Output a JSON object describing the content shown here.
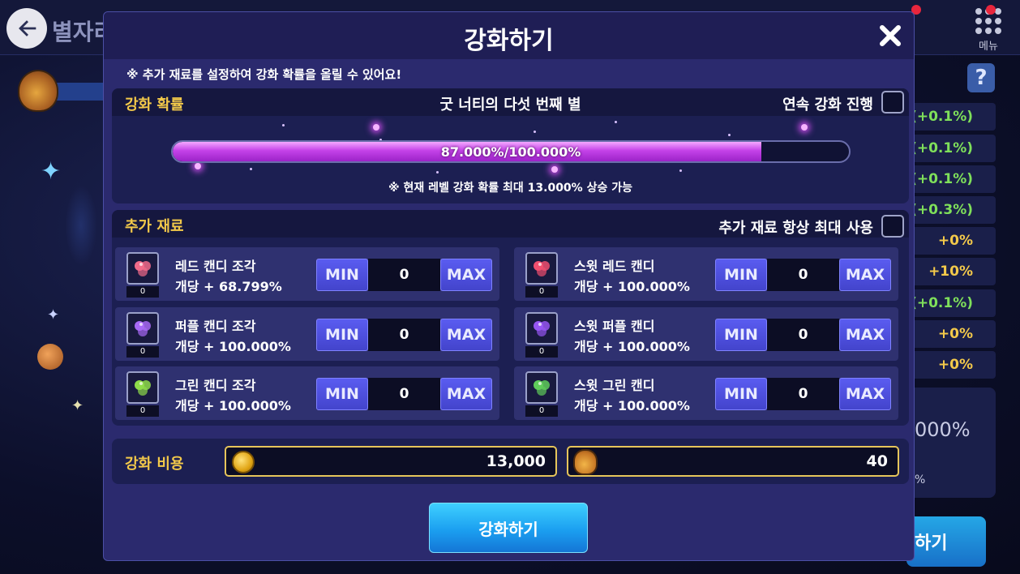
{
  "background": {
    "title": "별자리",
    "menu_label": "메뉴",
    "help_label": "?",
    "bonus_rows": [
      "(+0.1%)",
      "(+0.1%)",
      "(+0.1%)",
      "(+0.3%)",
      "+0%",
      "+10%",
      "(+0.1%)",
      "+0%",
      "+0%"
    ],
    "box_text": "000%",
    "box_subtext": "%",
    "button_label": "하기"
  },
  "modal": {
    "title": "강화하기",
    "notice": "※ 추가 재료를 설정하여 강화 확률을 올릴 수 있어요!",
    "probability": {
      "label": "강화 확률",
      "star_name": "굿 너티의 다섯 번째 별",
      "continuous_label": "연속 강화 진행",
      "continuous_checked": false,
      "progress_text": "87.000%/100.000%",
      "progress_fraction": 0.87,
      "max_notice": "※ 현재 레벨 강화 확률 최대 13.000% 상승 가능"
    },
    "materials": {
      "label": "추가 재료",
      "always_max_label": "추가 재료 항상 최대 사용",
      "always_max_checked": false,
      "min_label": "MIN",
      "max_label": "MAX",
      "items": [
        {
          "name": "레드 캔디 조각",
          "rate": "개당 + 68.799%",
          "owned": "0",
          "qty": "0",
          "color": "#f26b8a",
          "icon": "red-candy-piece-icon"
        },
        {
          "name": "스윗 레드 캔디",
          "rate": "개당 + 100.000%",
          "owned": "0",
          "qty": "0",
          "color": "#f04f6f",
          "icon": "sweet-red-candy-icon"
        },
        {
          "name": "퍼플 캔디 조각",
          "rate": "개당 + 100.000%",
          "owned": "0",
          "qty": "0",
          "color": "#a869f5",
          "icon": "purple-candy-piece-icon"
        },
        {
          "name": "스윗 퍼플 캔디",
          "rate": "개당 + 100.000%",
          "owned": "0",
          "qty": "0",
          "color": "#9656f2",
          "icon": "sweet-purple-candy-icon"
        },
        {
          "name": "그린 캔디 조각",
          "rate": "개당 + 100.000%",
          "owned": "0",
          "qty": "0",
          "color": "#8fdc4a",
          "icon": "green-candy-piece-icon"
        },
        {
          "name": "스윗 그린 캔디",
          "rate": "개당 + 100.000%",
          "owned": "0",
          "qty": "0",
          "color": "#5fcc5a",
          "icon": "sweet-green-candy-icon"
        }
      ]
    },
    "cost": {
      "label": "강화 비용",
      "coin_amount": "13,000",
      "candy_amount": "40"
    },
    "confirm_label": "강화하기"
  },
  "colors": {
    "accent_gold": "#f3c94a",
    "button_blue": "#4344cc",
    "progress_pink": "#c442e8",
    "bonus_green": "#7fe05a",
    "bonus_yellow": "#f3c94a"
  }
}
